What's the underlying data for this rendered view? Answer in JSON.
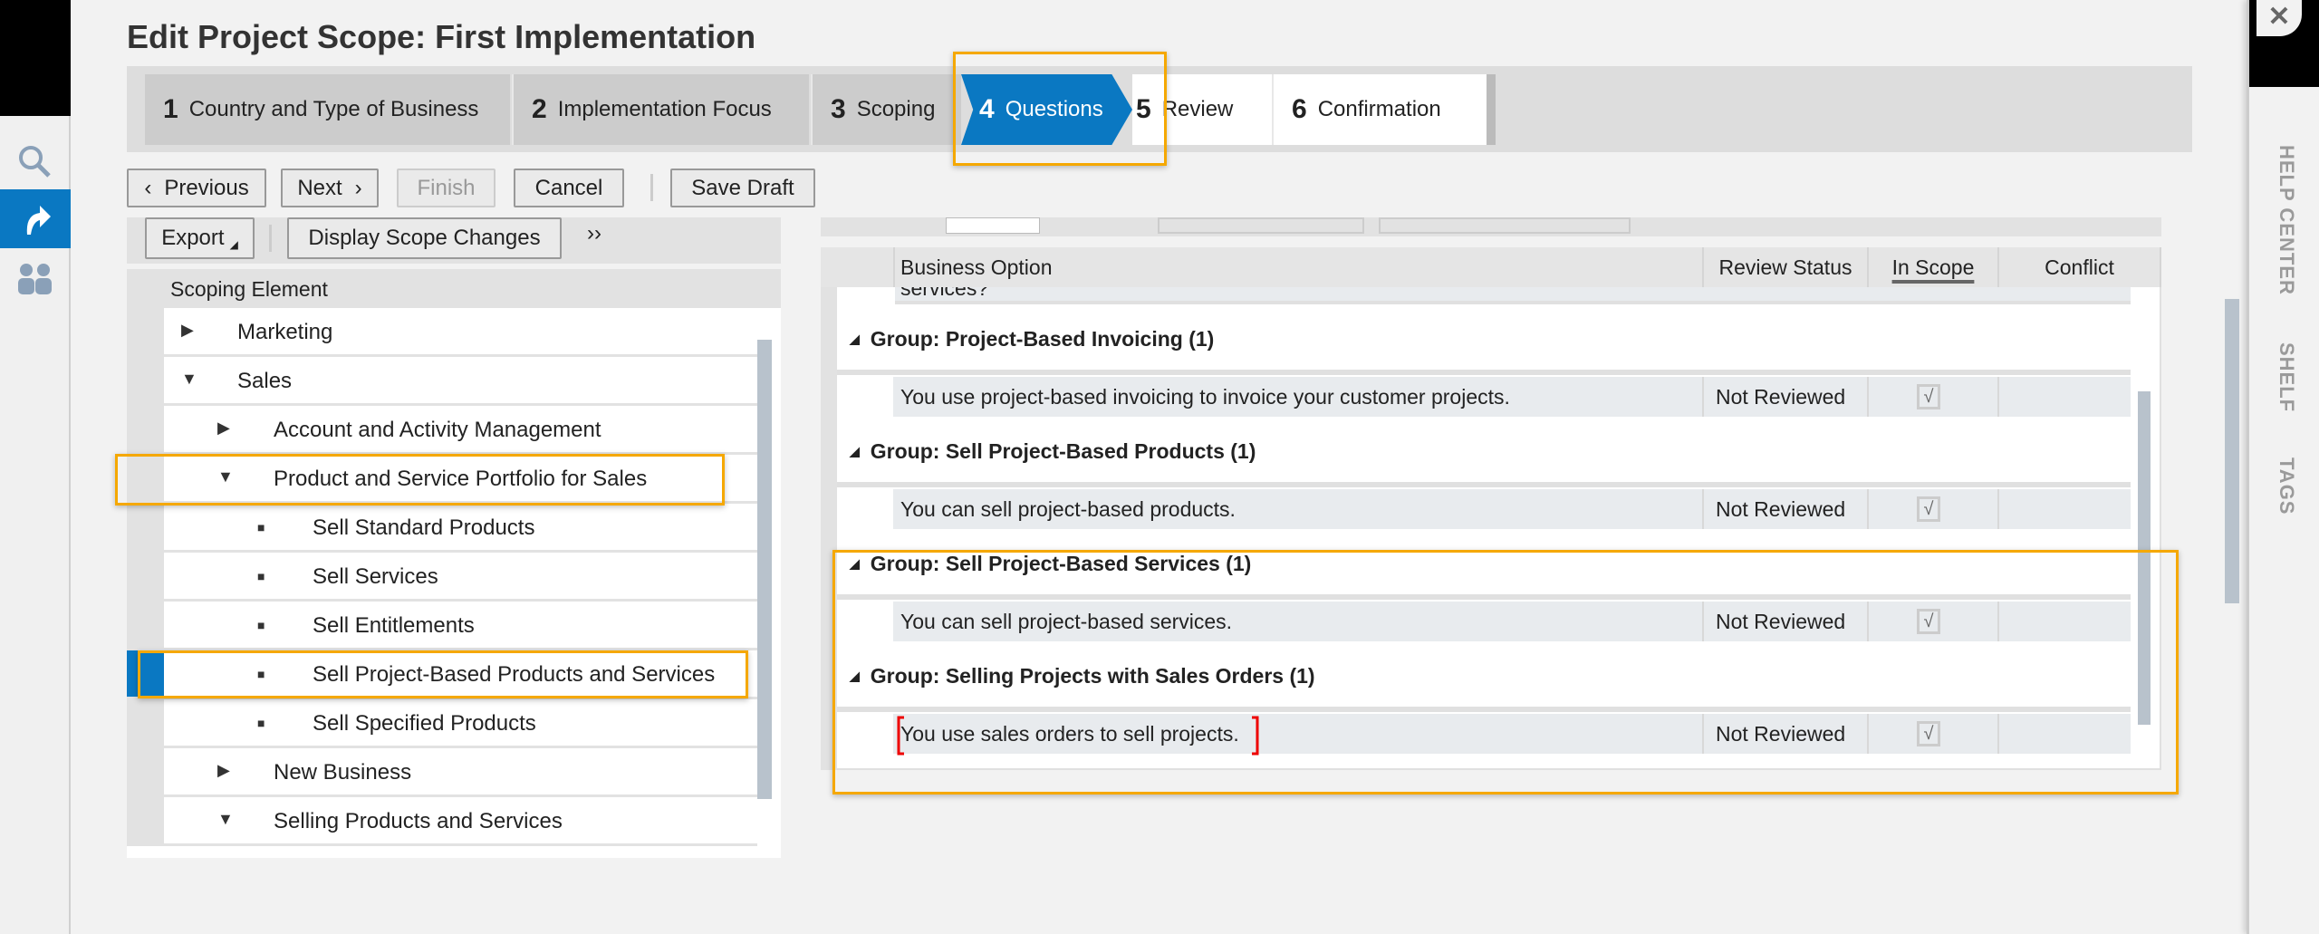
{
  "title": "Edit Project Scope: First Implementation",
  "wizard": {
    "steps": [
      {
        "num": "1",
        "label": "Country and Type of Business",
        "state": "done"
      },
      {
        "num": "2",
        "label": "Implementation Focus",
        "state": "done"
      },
      {
        "num": "3",
        "label": "Scoping",
        "state": "done"
      },
      {
        "num": "4",
        "label": "Questions",
        "state": "active"
      },
      {
        "num": "5",
        "label": "Review",
        "state": "todo"
      },
      {
        "num": "6",
        "label": "Confirmation",
        "state": "todo"
      }
    ]
  },
  "toolbar": {
    "previous": "Previous",
    "next": "Next",
    "finish": "Finish",
    "cancel": "Cancel",
    "save_draft": "Save Draft"
  },
  "left_panel": {
    "export": "Export",
    "display_scope_changes": "Display Scope Changes",
    "more": "››",
    "column": "Scoping Element",
    "items": [
      {
        "label": "Marketing",
        "icon": "triangle-right",
        "level": 0
      },
      {
        "label": "Sales",
        "icon": "triangle-down",
        "level": 0
      },
      {
        "label": "Account and Activity Management",
        "icon": "triangle-right",
        "level": 1
      },
      {
        "label": "Product and Service Portfolio for Sales",
        "icon": "triangle-down",
        "level": 1
      },
      {
        "label": "Sell Standard Products",
        "icon": "bullet",
        "level": 2
      },
      {
        "label": "Sell Services",
        "icon": "bullet",
        "level": 2
      },
      {
        "label": "Sell Entitlements",
        "icon": "bullet",
        "level": 2
      },
      {
        "label": "Sell Project-Based Products and Services",
        "icon": "bullet",
        "level": 2,
        "selected": true
      },
      {
        "label": "Sell Specified Products",
        "icon": "bullet",
        "level": 2
      },
      {
        "label": "New Business",
        "icon": "triangle-right",
        "level": 1
      },
      {
        "label": "Selling Products and Services",
        "icon": "triangle-down",
        "level": 1
      }
    ]
  },
  "right_panel": {
    "columns": [
      "Business Option",
      "Review Status",
      "In Scope",
      "Conflict"
    ],
    "partial_row": "services?",
    "groups": [
      {
        "title": "Group: Project-Based Invoicing (1)",
        "option": "You use project-based invoicing to invoice your customer projects.",
        "status": "Not Reviewed",
        "in_scope": true
      },
      {
        "title": "Group: Sell Project-Based Products (1)",
        "option": "You can sell project-based products.",
        "status": "Not Reviewed",
        "in_scope": true
      },
      {
        "title": "Group: Sell Project-Based Services (1)",
        "option": "You can sell project-based services.",
        "status": "Not Reviewed",
        "in_scope": true
      },
      {
        "title": "Group: Selling Projects with Sales Orders (1)",
        "option": "You use sales orders to sell projects.",
        "status": "Not Reviewed",
        "in_scope": true
      }
    ]
  },
  "right_sidebar": {
    "help_center": "HELP CENTER",
    "shelf": "SHELF",
    "tags": "TAGS"
  },
  "colors": {
    "accent": "#0a78c2",
    "highlight": "#f5a800"
  }
}
